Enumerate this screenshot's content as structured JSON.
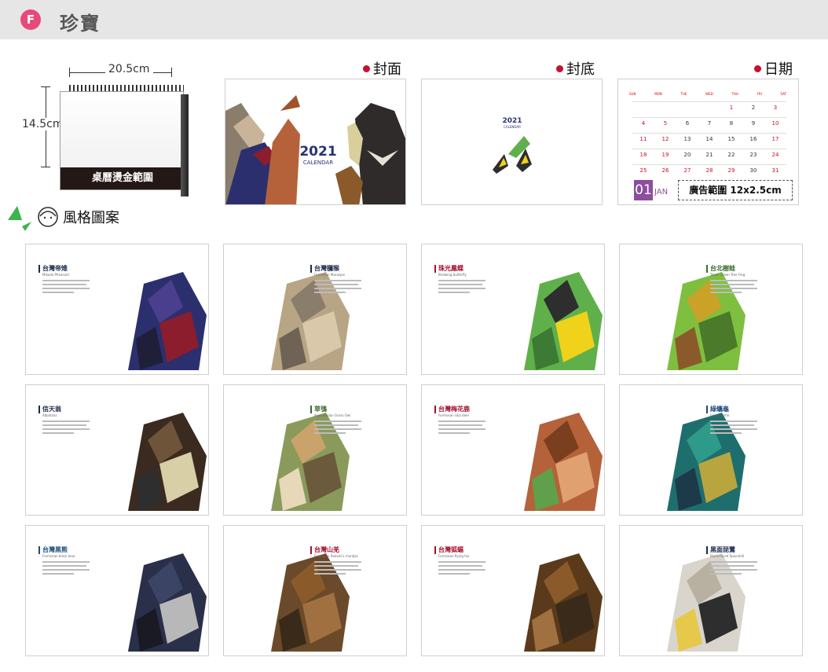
{
  "header": {
    "badge": "F",
    "title": "珍寶"
  },
  "product": {
    "width_label": "20.5cm",
    "height_label": "14.5cm",
    "band_text": "桌曆燙金範圍"
  },
  "sections": {
    "cover": "封面",
    "back": "封底",
    "date": "日期",
    "style": "風格圖案"
  },
  "cover": {
    "year": "2021",
    "sub": "CALENDAR"
  },
  "back": {
    "year": "2021",
    "sub": "CALENDAR"
  },
  "date_panel": {
    "weekdays": [
      "SUN",
      "MON",
      "TUE",
      "WED",
      "THU",
      "FRI",
      "SAT"
    ],
    "days": [
      "",
      "",
      "",
      "",
      "1",
      "2",
      "3",
      "4",
      "5",
      "6",
      "7",
      "8",
      "9",
      "10",
      "11",
      "12",
      "13",
      "14",
      "15",
      "16",
      "17",
      "18",
      "19",
      "20",
      "21",
      "22",
      "23",
      "24",
      "25",
      "26",
      "27",
      "28",
      "29",
      "30",
      "31"
    ],
    "red_days": [
      "1",
      "3",
      "4",
      "5",
      "10",
      "11",
      "12",
      "17",
      "18",
      "19",
      "24",
      "25",
      "26",
      "27",
      "28",
      "29",
      "31"
    ],
    "month_num": "01",
    "month_name": "JAN",
    "ad_text": "廣告範圍 12x2.5cm"
  },
  "styles": [
    {
      "title": "台灣帝雉",
      "sub": "Mikado Pheasant",
      "color": "dark"
    },
    {
      "title": "台灣獼猴",
      "sub": "Formosan Macaque",
      "color": "dark"
    },
    {
      "title": "珠光鳳蝶",
      "sub": "Birdwing butterfly",
      "color": "red"
    },
    {
      "title": "台北樹蛙",
      "sub": "Taipei Green Tree Frog",
      "color": "green"
    },
    {
      "title": "信天翁",
      "sub": "Albatross",
      "color": "dark"
    },
    {
      "title": "草鴞",
      "sub": "Australasian Grass Owl",
      "color": "green"
    },
    {
      "title": "台灣梅花鹿",
      "sub": "Formosan sika deer",
      "color": "red"
    },
    {
      "title": "綠蠵龜",
      "sub": "Green turtle",
      "color": "blue"
    },
    {
      "title": "台灣黑熊",
      "sub": "Formosan black bear",
      "color": "blue"
    },
    {
      "title": "台灣山羌",
      "sub": "Formosan Reeves's muntjac",
      "color": "red"
    },
    {
      "title": "台灣狐蝠",
      "sub": "Formosan flying fox",
      "color": "red"
    },
    {
      "title": "黑面琵鷺",
      "sub": "Black-faced Spoonbill",
      "color": "dark"
    }
  ]
}
